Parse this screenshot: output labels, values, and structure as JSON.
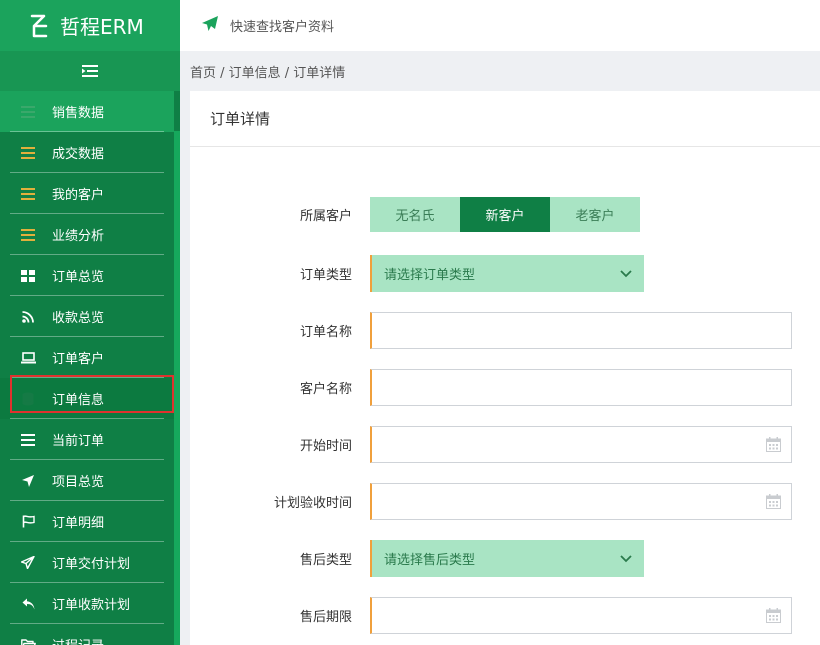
{
  "brand": {
    "name": "哲程ERM"
  },
  "topbar": {
    "search_text": "快速查找客户资料"
  },
  "breadcrumb": {
    "text": "首页 / 订单信息 / 订单详情"
  },
  "sidebar": {
    "items": [
      {
        "label": "销售数据",
        "icon": "list-icon"
      },
      {
        "label": "成交数据",
        "icon": "list-icon"
      },
      {
        "label": "我的客户",
        "icon": "list-icon"
      },
      {
        "label": "业绩分析",
        "icon": "list-icon"
      },
      {
        "label": "订单总览",
        "icon": "dashboard-icon"
      },
      {
        "label": "收款总览",
        "icon": "rss-icon"
      },
      {
        "label": "订单客户",
        "icon": "laptop-icon"
      },
      {
        "label": "订单信息",
        "icon": "database-icon"
      },
      {
        "label": "当前订单",
        "icon": "list-icon"
      },
      {
        "label": "项目总览",
        "icon": "location-arrow-icon"
      },
      {
        "label": "订单明细",
        "icon": "flag-icon"
      },
      {
        "label": "订单交付计划",
        "icon": "send-icon"
      },
      {
        "label": "订单收款计划",
        "icon": "reply-icon"
      },
      {
        "label": "过程记录",
        "icon": "folder-open-icon"
      }
    ],
    "selected_index": 7
  },
  "main": {
    "title": "订单详情",
    "form": {
      "customer_type_label": "所属客户",
      "customer_type_options": [
        "无名氏",
        "新客户",
        "老客户"
      ],
      "customer_type_selected": "新客户",
      "order_type_label": "订单类型",
      "order_type_placeholder": "请选择订单类型",
      "order_name_label": "订单名称",
      "order_name_value": "",
      "customer_name_label": "客户名称",
      "customer_name_value": "",
      "start_time_label": "开始时间",
      "start_time_value": "",
      "acceptance_time_label": "计划验收时间",
      "acceptance_time_value": "",
      "after_sale_type_label": "售后类型",
      "after_sale_type_placeholder": "请选择售后类型",
      "after_sale_period_label": "售后期限",
      "after_sale_period_value": ""
    }
  },
  "colors": {
    "sidebar_bg": "#0f7f45",
    "brand_bg": "#1ba35c",
    "accent_light": "#a9e4c4",
    "input_accent": "#f0a03c",
    "selection_outline": "#e0322e"
  }
}
